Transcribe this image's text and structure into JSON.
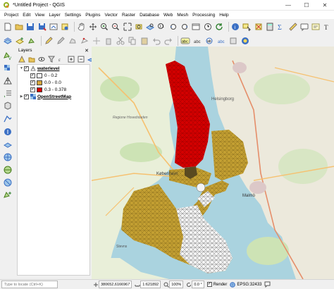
{
  "window": {
    "title": "*Untitled Project - QGIS",
    "controls": [
      "—",
      "☐",
      "✕"
    ]
  },
  "menu": [
    "Project",
    "Edit",
    "View",
    "Layer",
    "Settings",
    "Plugins",
    "Vector",
    "Raster",
    "Database",
    "Web",
    "Mesh",
    "Processing",
    "Help"
  ],
  "layers_panel": {
    "title": "Layers",
    "close_glyph": "✕",
    "layers": [
      {
        "name": "waterlevel",
        "checked": true,
        "type": "mesh"
      },
      {
        "name": "OpenStreetMap",
        "checked": true,
        "type": "raster"
      }
    ],
    "legend": [
      {
        "label": "0 - 0.2",
        "color": "#ffffff",
        "checked": true
      },
      {
        "label": "0.0 - 0.0",
        "color": "#d4a63a",
        "checked": true
      },
      {
        "label": "0.3 - 0.378",
        "color": "#d40000",
        "checked": true
      }
    ]
  },
  "map": {
    "place_labels": [
      "Helsingborg",
      "Regione Hovedstaden",
      "København",
      "Malmö",
      "Stevns"
    ]
  },
  "status": {
    "locator_placeholder": "Type to locate (Ctrl+K)",
    "coordinate_value": "380652,6166967",
    "scale_value": "1:621892",
    "magnifier_value": "100%",
    "rotation_value": "0.0 °",
    "render_label": "Render",
    "crs_label": "EPSG:32433"
  },
  "colors": {
    "mesh_red": "#d40000",
    "mesh_gold": "#c4a032",
    "mesh_white": "#f4f4f4",
    "water": "#aad3df",
    "land": "#f2efe9"
  }
}
